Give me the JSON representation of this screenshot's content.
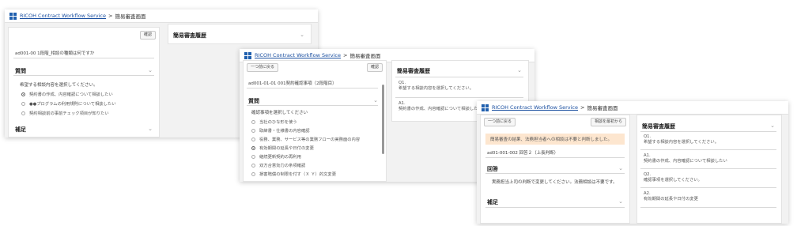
{
  "app": {
    "name": "RICOH Contract Workflow Service",
    "page": "簡易審査画面",
    "separator": ">"
  },
  "win1": {
    "confirm_button": "確認",
    "ticket": "ad001-00 1段階_相談の種類は何ですか",
    "question_heading": "質問",
    "prompt": "希望する相談内容を選択してください。",
    "options": [
      {
        "label": "契約書の作成、内容確認について相談したい",
        "selected": true
      },
      {
        "label": "●●プログラムの利用規則について相談したい",
        "selected": false
      },
      {
        "label": "契約相談前の事前チェック項目が知りたい",
        "selected": false
      }
    ],
    "supplement_heading": "補足",
    "history_heading": "簡易審査履歴"
  },
  "win2": {
    "back_button": "一つ前に戻る",
    "confirm_button": "確認",
    "ticket": "ad001-01-01 001契約確認事項（2段階目）",
    "question_heading": "質問",
    "prompt": "確認事項を選択してください",
    "options": [
      {
        "label": "当社のひな形を使う",
        "selected": false
      },
      {
        "label": "取締書・仕様書の内容確認",
        "selected": false
      },
      {
        "label": "役務、業務、サービス等の業務フローの実務面の内容",
        "selected": false
      },
      {
        "label": "有効期間の延長や日付の変更",
        "selected": true
      },
      {
        "label": "継続更新契約の再利用",
        "selected": false
      },
      {
        "label": "双方合意効力の条項確認",
        "selected": false
      },
      {
        "label": "損害賠償の制限を付す（Ｘ Ｙ）的文変更",
        "selected": false
      }
    ],
    "history_heading": "簡易審査履歴",
    "history": [
      {
        "q": "Q1.",
        "text": "希望する相談内容を選択してください。"
      },
      {
        "q": "A1.",
        "text": "契約書の作成、内容確認について相談したい"
      }
    ]
  },
  "win3": {
    "back_button": "一つ前に戻る",
    "reset_button": "相談を最初から",
    "notice": "簡易審査の結果、法務担当者への相談は不要と判断しました。",
    "ticket": "ad01-001-002 回答２（上長判断）",
    "answer_heading": "回答",
    "answer_text": "実務担当上司の判断で変更してください。法務相談は不要です。",
    "supplement_heading": "補足",
    "history_heading": "簡易審査履歴",
    "history": [
      {
        "q": "Q1.",
        "text": "希望する相談内容を選択してください。"
      },
      {
        "q": "A1.",
        "text": "契約書の作成、内容確認について相談したい"
      },
      {
        "q": "Q2.",
        "text": "確認事項を選択してください。"
      },
      {
        "q": "A2.",
        "text": "有効期間の延長や日付の変更"
      }
    ]
  }
}
